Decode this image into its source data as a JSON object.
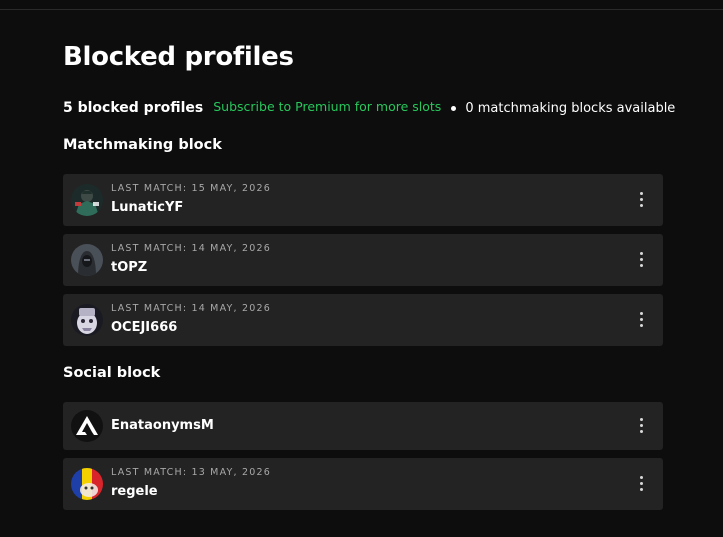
{
  "page": {
    "title": "Blocked profiles"
  },
  "summary": {
    "count_label": "5 blocked profiles",
    "premium_link": "Subscribe to Premium for more slots",
    "available_label": "0 matchmaking blocks available"
  },
  "matchmaking": {
    "title": "Matchmaking block",
    "items": [
      {
        "last_match": "LAST MATCH: 15 MAY, 2026",
        "name": "LunaticYF",
        "avatar_icon": "soldier-avatar-icon"
      },
      {
        "last_match": "LAST MATCH: 14 MAY, 2026",
        "name": "tOPZ",
        "avatar_icon": "hooded-avatar-icon"
      },
      {
        "last_match": "LAST MATCH: 14 MAY, 2026",
        "name": "OCEJI666",
        "avatar_icon": "creature-avatar-icon"
      }
    ]
  },
  "social": {
    "title": "Social block",
    "items": [
      {
        "last_match": "",
        "name": "EnataonymsM",
        "avatar_icon": "triangle-logo-avatar-icon"
      },
      {
        "last_match": "LAST MATCH: 13 MAY, 2026",
        "name": "regele",
        "avatar_icon": "flag-avatar-icon"
      }
    ]
  },
  "colors": {
    "background": "#0d0d0d",
    "row_background": "#232323",
    "accent_green": "#27c75c",
    "meta_text": "#a8a8a8"
  }
}
